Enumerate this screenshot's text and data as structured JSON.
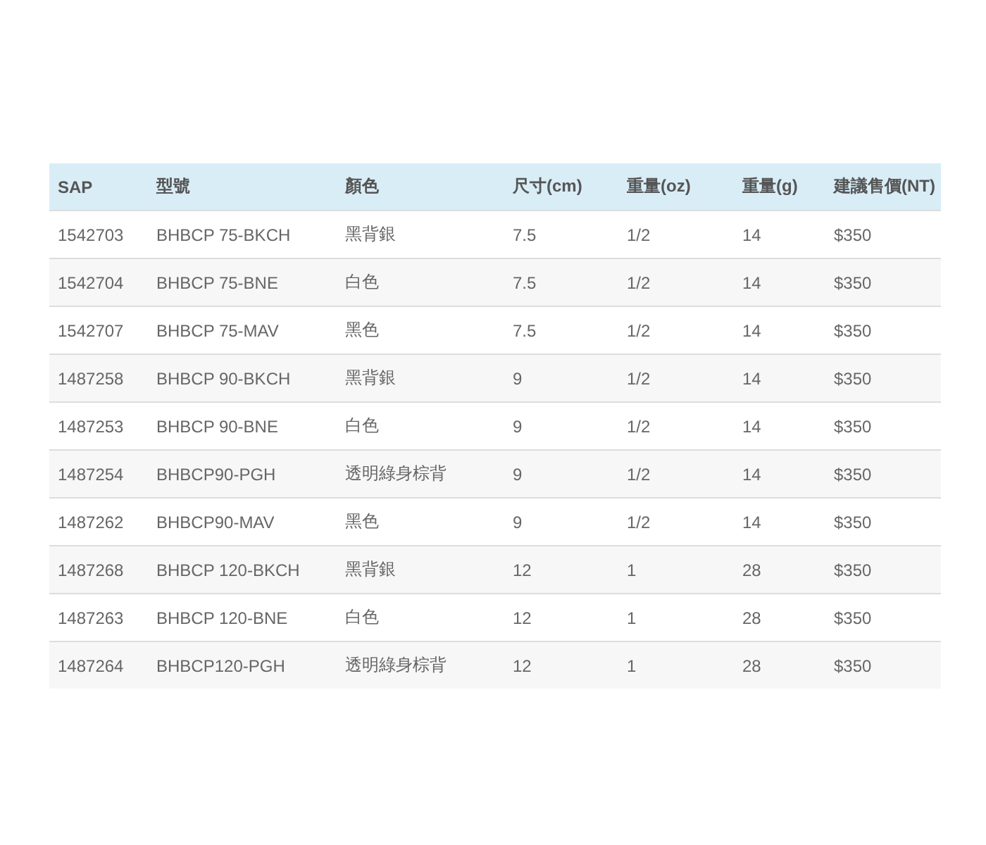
{
  "table": {
    "columns": [
      "SAP",
      "型號",
      "顏色",
      "尺寸(cm)",
      "重量(oz)",
      "重量(g)",
      "建議售價(NT)"
    ],
    "rows": [
      [
        "1542703",
        "BHBCP 75-BKCH",
        "黑背銀",
        "7.5",
        "1/2",
        "14",
        "$350"
      ],
      [
        "1542704",
        "BHBCP 75-BNE",
        "白色",
        "7.5",
        "1/2",
        "14",
        "$350"
      ],
      [
        "1542707",
        "BHBCP 75-MAV",
        "黑色",
        "7.5",
        "1/2",
        "14",
        "$350"
      ],
      [
        "1487258",
        "BHBCP 90-BKCH",
        "黑背銀",
        "9",
        "1/2",
        "14",
        "$350"
      ],
      [
        "1487253",
        "BHBCP 90-BNE",
        "白色",
        "9",
        "1/2",
        "14",
        "$350"
      ],
      [
        "1487254",
        "BHBCP90-PGH",
        "透明綠身棕背",
        "9",
        "1/2",
        "14",
        "$350"
      ],
      [
        "1487262",
        "BHBCP90-MAV",
        "黑色",
        "9",
        "1/2",
        "14",
        "$350"
      ],
      [
        "1487268",
        "BHBCP 120-BKCH",
        "黑背銀",
        "12",
        "1",
        "28",
        "$350"
      ],
      [
        "1487263",
        "BHBCP 120-BNE",
        "白色",
        "12",
        "1",
        "28",
        "$350"
      ],
      [
        "1487264",
        "BHBCP120-PGH",
        "透明綠身棕背",
        "12",
        "1",
        "28",
        "$350"
      ]
    ]
  }
}
